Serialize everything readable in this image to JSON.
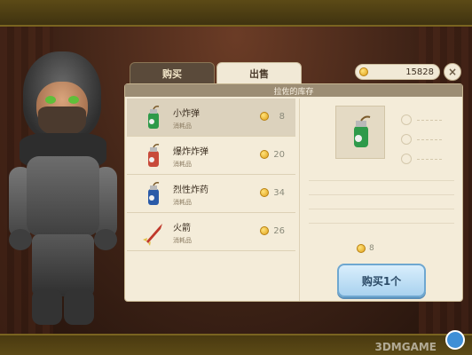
{
  "tabs": [
    {
      "label": "购买",
      "active": true
    },
    {
      "label": "出售",
      "active": false
    }
  ],
  "gold": "15828",
  "close_label": "×",
  "shop_title": "拉佐的库存",
  "items": [
    {
      "name": "小炸弹",
      "type": "消耗品",
      "price": "8",
      "icon": "small-bomb-icon",
      "selected": true
    },
    {
      "name": "爆炸炸弹",
      "type": "消耗品",
      "price": "20",
      "icon": "explosive-bomb-icon",
      "selected": false
    },
    {
      "name": "烈性炸药",
      "type": "消耗品",
      "price": "34",
      "icon": "dynamite-icon",
      "selected": false
    },
    {
      "name": "火箭",
      "type": "消耗品",
      "price": "26",
      "icon": "rocket-icon",
      "selected": false
    }
  ],
  "detail": {
    "price": "8",
    "buy_label": "购买1个"
  },
  "watermark": "3DMGAME",
  "colors": {
    "buy_button": "#a9d2ef",
    "panel": "#f4ecd9",
    "header": "#9c8d74"
  }
}
